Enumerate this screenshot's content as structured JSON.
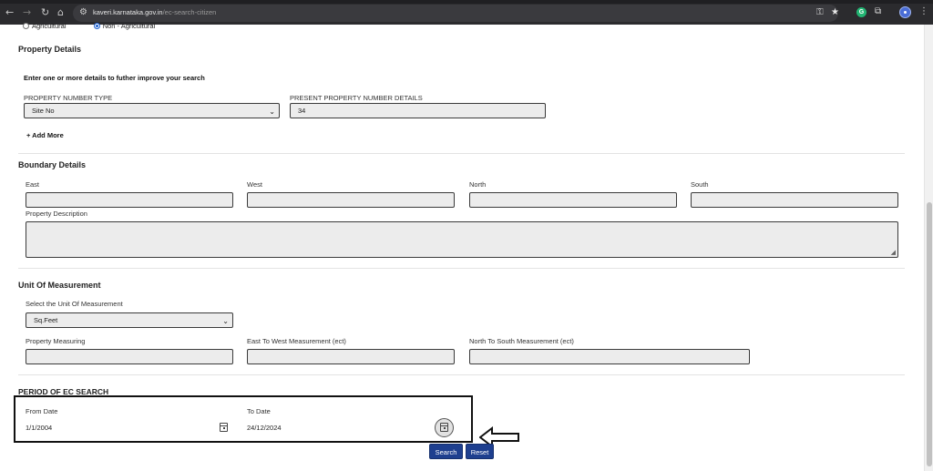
{
  "browser": {
    "url_domain": "kaveri.karnataka.gov.in",
    "url_path": "/ec-search-citizen"
  },
  "property_type": {
    "options": [
      {
        "label": "Agricultural",
        "checked": false
      },
      {
        "label": "Non - Agricultural",
        "checked": true
      }
    ]
  },
  "property_details": {
    "title": "Property Details",
    "hint": "Enter one or more details to futher improve your search",
    "number_type_label": "PROPERTY NUMBER TYPE",
    "number_type_value": "Site No",
    "number_details_label": "PRESENT PROPERTY NUMBER DETAILS",
    "number_details_value": "34",
    "add_more": "+ Add More"
  },
  "boundary_details": {
    "title": "Boundary Details",
    "east_label": "East",
    "west_label": "West",
    "north_label": "North",
    "south_label": "South",
    "east_value": "",
    "west_value": "",
    "north_value": "",
    "south_value": "",
    "description_label": "Property Description",
    "description_value": ""
  },
  "unit_of_measurement": {
    "title": "Unit Of Measurement",
    "select_label": "Select the Unit Of Measurement",
    "select_value": "Sq.Feet",
    "measuring_label": "Property Measuring",
    "east_west_label": "East To West Measurement (ect)",
    "north_south_label": "North To South Measurement (ect)",
    "measuring_value": "",
    "east_west_value": "",
    "north_south_value": ""
  },
  "ec_period": {
    "title": "PERIOD OF EC SEARCH",
    "from_label": "From Date",
    "from_value": "1/1/2004",
    "to_label": "To Date",
    "to_value": "24/12/2024"
  },
  "actions": {
    "search": "Search",
    "reset": "Reset"
  },
  "icons": {
    "back": "back-arrow-icon",
    "forward": "forward-arrow-icon",
    "reload": "reload-icon",
    "home": "home-icon",
    "site_info": "tune-icon",
    "password": "key-icon",
    "bookmark": "star-icon",
    "extension_g": "grammarly-icon",
    "extensions": "puzzle-icon",
    "menu": "kebab-menu-icon",
    "calendar": "calendar-icon",
    "pointer": "left-arrow-icon"
  },
  "colors": {
    "button_bg": "#1e3f8f",
    "radio_accent": "#1a5fd0",
    "browser_bar": "#2b2b2e"
  }
}
